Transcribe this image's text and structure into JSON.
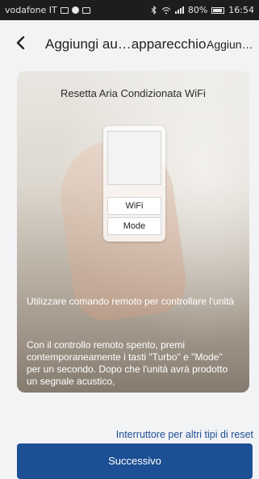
{
  "status_bar": {
    "carrier": "vodafone IT",
    "battery": "80%",
    "time": "16:54"
  },
  "app_bar": {
    "title": "Aggiungi au…apparecchio",
    "action": "Aggiun…"
  },
  "card": {
    "title": "Resetta Aria Condizionata WiFi",
    "remote_buttons": [
      "WiFi",
      "Mode"
    ],
    "instruction_1": "Utilizzare comando remoto per controllare l'unità",
    "instruction_2": "Con il controllo remoto spento, premi contemporaneamente i tasti \"Turbo\" e \"Mode\" per un secondo. Dopo che l'unità avrà prodotto un segnale acustico,"
  },
  "reset_link": "Interruttore per altri tipi di reset",
  "next_button": "Successivo",
  "colors": {
    "accent": "#1c4f93",
    "link": "#1f4e96",
    "background": "#f2f3f5",
    "statusbar": "#1d1d1d"
  },
  "icons": [
    "mail-icon",
    "settings-icon",
    "image-icon",
    "bluetooth-icon",
    "wifi-icon",
    "signal-icon",
    "battery-icon",
    "back-arrow-icon"
  ]
}
